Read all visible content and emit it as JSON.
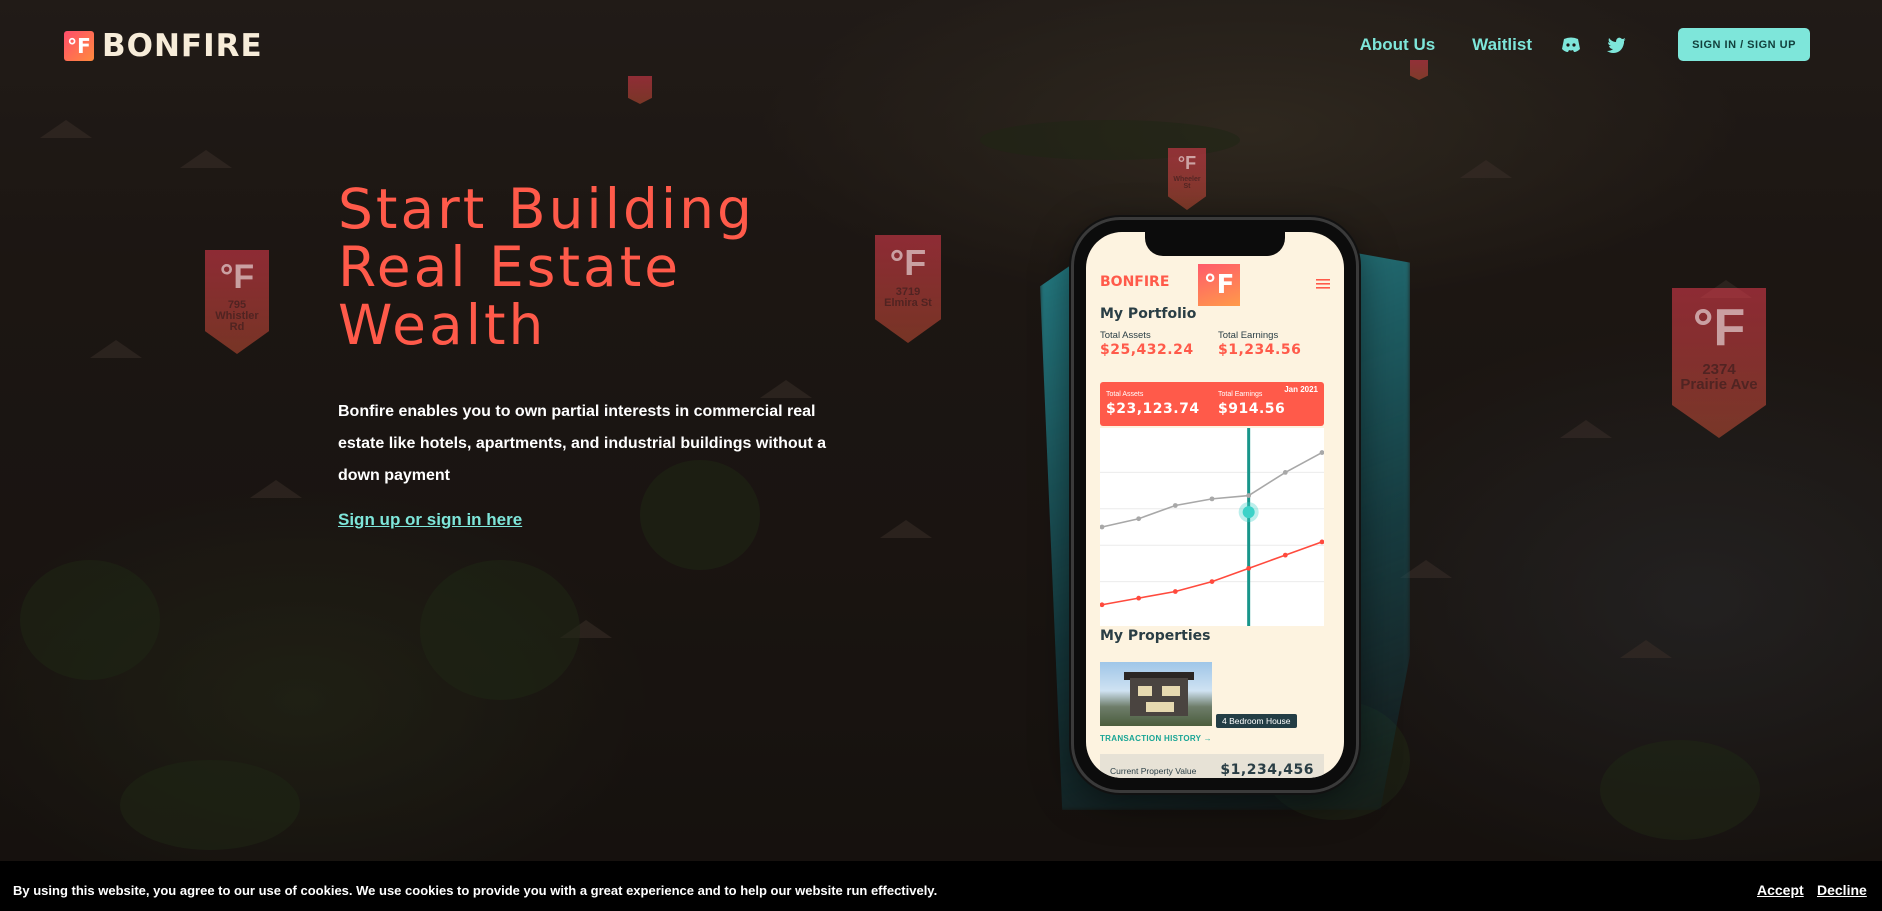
{
  "brand": {
    "logo_glyph": "°F",
    "name": "BONFIRE"
  },
  "nav": {
    "about": "About Us",
    "waitlist": "Waitlist",
    "discord_icon": "discord-icon",
    "twitter_icon": "twitter-icon",
    "signin": "SIGN IN / SIGN UP"
  },
  "hero": {
    "title_line1": "Start Building",
    "title_line2": "Real Estate",
    "title_line3": "Wealth",
    "description": "Bonfire enables you to own partial interests in commercial real estate like hotels,  apartments, and industrial  buildings without a down payment",
    "link": "Sign up or sign in here"
  },
  "markers": [
    {
      "glyph": "°F",
      "address": "795 Whistler Rd"
    },
    {
      "glyph": "°F",
      "address": "3719 Elmira St"
    },
    {
      "glyph": "°F",
      "address": "Wheeler St"
    },
    {
      "glyph": "°F",
      "address": "2374 Prairie Ave"
    }
  ],
  "app": {
    "logo": "BONFIRE",
    "badge": "°F",
    "menu_icon": "hamburger-icon",
    "portfolio_title": "My Portfolio",
    "total_assets_label": "Total Assets",
    "total_assets_value": "$25,432.24",
    "total_earnings_label": "Total Earnings",
    "total_earnings_value": "$1,234.56",
    "card": {
      "assets_label": "Total Assets",
      "assets_value": "$23,123.74",
      "earnings_label": "Total Earnings",
      "earnings_value": "$914.56",
      "date": "Jan 2021"
    },
    "properties_title": "My Properties",
    "property_tag": "4 Bedroom House",
    "transaction_link": "TRANSACTION HISTORY  →",
    "current_value_label": "Current Property Value",
    "current_value": "$1,234,456"
  },
  "chart_data": {
    "type": "line",
    "x": [
      0,
      1,
      2,
      3,
      4,
      5,
      6
    ],
    "series": [
      {
        "values": [
          55,
          60,
          68,
          72,
          74,
          88,
          100
        ],
        "color": "#a8a8a8"
      },
      {
        "values": [
          8,
          12,
          16,
          22,
          30,
          38,
          46
        ],
        "color": "#ff4a3d"
      }
    ],
    "ylim": [
      0,
      110
    ],
    "highlight_x": 4,
    "grid": true
  },
  "cookie": {
    "text": "By using this website, you agree to our use of cookies. We use cookies to provide you with a great experience and to help our website run effectively.",
    "accept": "Accept",
    "decline": "Decline"
  }
}
